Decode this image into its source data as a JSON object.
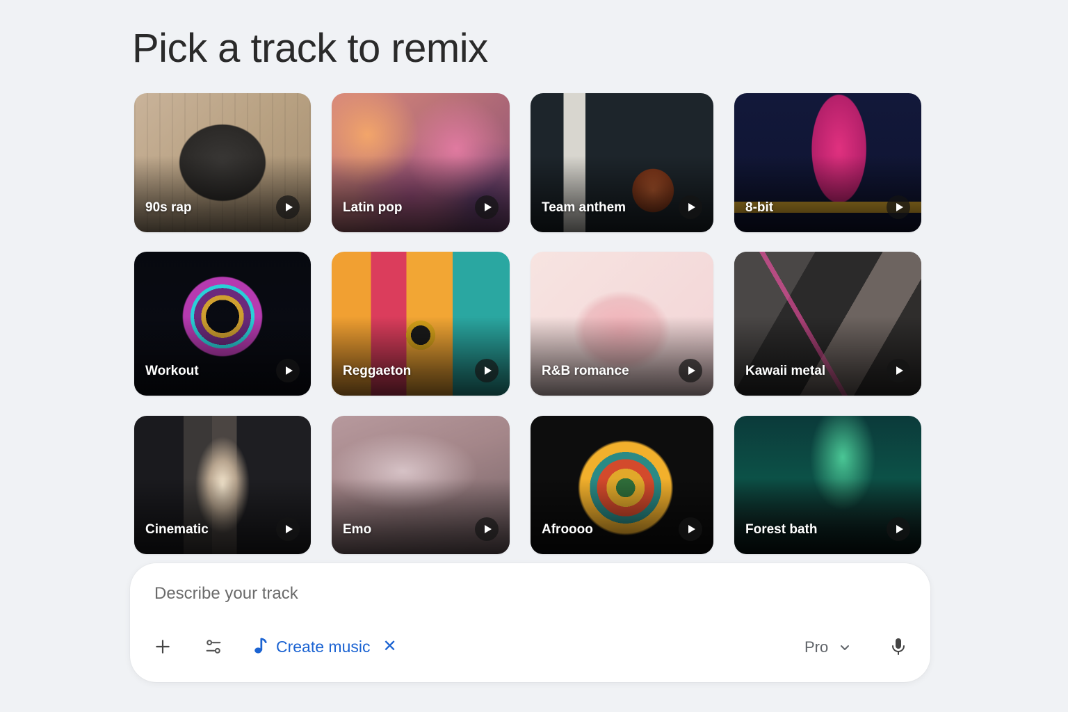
{
  "title": "Pick a track to remix",
  "tracks": [
    {
      "label": "90s rap"
    },
    {
      "label": "Latin pop"
    },
    {
      "label": "Team anthem"
    },
    {
      "label": "8-bit"
    },
    {
      "label": "Workout"
    },
    {
      "label": "Reggaeton"
    },
    {
      "label": "R&B romance"
    },
    {
      "label": "Kawaii metal"
    },
    {
      "label": "Cinematic"
    },
    {
      "label": "Emo"
    },
    {
      "label": "Afroooo"
    },
    {
      "label": "Forest bath"
    }
  ],
  "prompt": {
    "placeholder": "Describe your track",
    "value": "",
    "chip_label": "Create music",
    "model_label": "Pro"
  },
  "icons": {
    "play": "play-icon",
    "add": "plus-icon",
    "tools": "tune-icon",
    "chip": "music-note-icon",
    "remove": "close-icon",
    "model": "chevron-down-icon",
    "voice": "microphone-icon"
  },
  "colors": {
    "background": "#f0f2f5",
    "accent": "#1b63d2",
    "muted_text": "#5f6368"
  }
}
